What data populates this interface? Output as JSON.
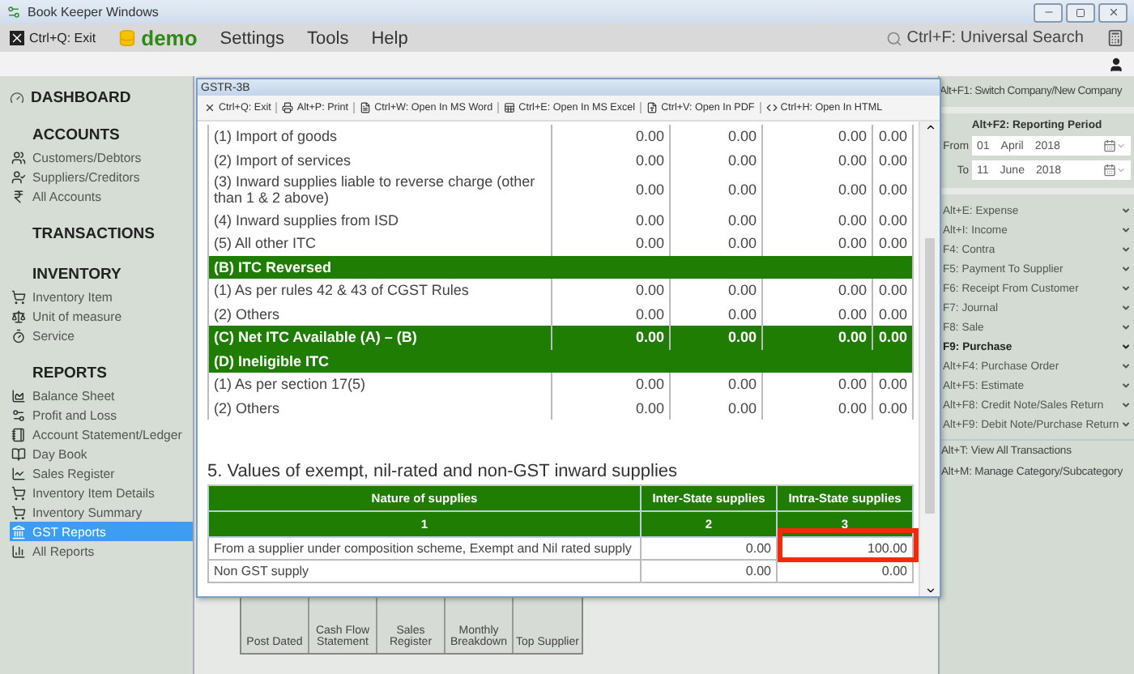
{
  "window": {
    "title": "Book Keeper Windows"
  },
  "menu_bar": {
    "exit": "Ctrl+Q: Exit",
    "company": "demo",
    "items": [
      "Settings",
      "Tools",
      "Help"
    ],
    "search": "Ctrl+F: Universal Search"
  },
  "sidebar": {
    "dashboard": "DASHBOARD",
    "sections": [
      {
        "title": "ACCOUNTS",
        "items": [
          {
            "label": "Customers/Debtors",
            "selected": false
          },
          {
            "label": "Suppliers/Creditors",
            "selected": false
          },
          {
            "label": "All Accounts",
            "selected": false
          }
        ]
      },
      {
        "title": "TRANSACTIONS"
      },
      {
        "title": "INVENTORY",
        "items": [
          {
            "label": "Inventory Item",
            "selected": false
          },
          {
            "label": "Unit of measure",
            "selected": false
          },
          {
            "label": "Service",
            "selected": false
          }
        ]
      },
      {
        "title": "REPORTS",
        "items": [
          {
            "label": "Balance Sheet",
            "selected": false
          },
          {
            "label": "Profit and Loss",
            "selected": false
          },
          {
            "label": "Account Statement/Ledger",
            "selected": false
          },
          {
            "label": "Day Book",
            "selected": false
          },
          {
            "label": "Sales Register",
            "selected": false
          },
          {
            "label": "Inventory Item Details",
            "selected": false
          },
          {
            "label": "Inventory Summary",
            "selected": false
          },
          {
            "label": "GST Reports",
            "selected": true
          },
          {
            "label": "All Reports",
            "selected": false
          }
        ]
      }
    ]
  },
  "dashboard_tiles": [
    "Post Dated",
    "Cash Flow Statement",
    "Sales Register",
    "Monthly Breakdown",
    "Top Supplier"
  ],
  "dialog": {
    "title": "GSTR-3B",
    "toolbar": [
      "Ctrl+Q: Exit",
      "Alt+P: Print",
      "Ctrl+W: Open In MS Word",
      "Ctrl+E: Open In MS Excel",
      "Ctrl+V: Open In PDF",
      "Ctrl+H: Open In HTML"
    ],
    "itc_rows": [
      {
        "kind": "item",
        "label": "(1) Import of goods",
        "values": [
          "0.00",
          "0.00",
          "0.00",
          "0.00"
        ]
      },
      {
        "kind": "item",
        "label": "(2) Import of services",
        "values": [
          "0.00",
          "0.00",
          "0.00",
          "0.00"
        ]
      },
      {
        "kind": "item",
        "label": "(3) Inward supplies liable to reverse charge (other than 1 & 2 above)",
        "values": [
          "0.00",
          "0.00",
          "0.00",
          "0.00"
        ]
      },
      {
        "kind": "item",
        "label": "(4) Inward supplies from ISD",
        "values": [
          "0.00",
          "0.00",
          "0.00",
          "0.00"
        ]
      },
      {
        "kind": "item",
        "label": "(5) All other ITC",
        "values": [
          "0.00",
          "0.00",
          "0.00",
          "0.00"
        ]
      },
      {
        "kind": "group",
        "label": "(B) ITC Reversed"
      },
      {
        "kind": "item",
        "label": "(1) As per rules 42 & 43 of CGST Rules",
        "values": [
          "0.00",
          "0.00",
          "0.00",
          "0.00"
        ]
      },
      {
        "kind": "item",
        "label": "(2) Others",
        "values": [
          "0.00",
          "0.00",
          "0.00",
          "0.00"
        ]
      },
      {
        "kind": "total",
        "label": "(C) Net ITC Available (A) – (B)",
        "values": [
          "0.00",
          "0.00",
          "0.00",
          "0.00"
        ]
      },
      {
        "kind": "group",
        "label": "(D) Ineligible ITC"
      },
      {
        "kind": "item",
        "label": "(1) As per section 17(5)",
        "values": [
          "0.00",
          "0.00",
          "0.00",
          "0.00"
        ]
      },
      {
        "kind": "item",
        "label": "(2) Others",
        "values": [
          "0.00",
          "0.00",
          "0.00",
          "0.00"
        ]
      }
    ],
    "section5": {
      "title": "5. Values of exempt, nil-rated and non-GST inward supplies",
      "columns": [
        "Nature of supplies",
        "Inter-State supplies",
        "Intra-State supplies"
      ],
      "column_numbers": [
        "1",
        "2",
        "3"
      ],
      "rows": [
        {
          "nature": "From a supplier under composition scheme, Exempt and Nil rated supply",
          "inter": "0.00",
          "intra": "100.00",
          "highlighted": true
        },
        {
          "nature": "Non GST supply",
          "inter": "0.00",
          "intra": "0.00",
          "highlighted": false
        }
      ]
    }
  },
  "right_panel": {
    "switch_company": "Alt+F1: Switch Company/New Company",
    "reporting_period": {
      "title": "Alt+F2: Reporting Period",
      "rows": [
        {
          "label": "From",
          "day": "01",
          "month": "April",
          "year": "2018"
        },
        {
          "label": "To",
          "day": "11",
          "month": "June",
          "year": "2018"
        }
      ]
    },
    "shortcuts": [
      {
        "label": "Alt+E: Expense",
        "selected": false
      },
      {
        "label": "Alt+I: Income",
        "selected": false
      },
      {
        "label": "F4: Contra",
        "selected": false
      },
      {
        "label": "F5: Payment To Supplier",
        "selected": false
      },
      {
        "label": "F6: Receipt From Customer",
        "selected": false
      },
      {
        "label": "F7: Journal",
        "selected": false
      },
      {
        "label": "F8: Sale",
        "selected": false
      },
      {
        "label": "F9: Purchase",
        "selected": true
      },
      {
        "label": "Alt+F4: Purchase Order",
        "selected": false
      },
      {
        "label": "Alt+F5: Estimate",
        "selected": false
      },
      {
        "label": "Alt+F8: Credit Note/Sales Return",
        "selected": false
      },
      {
        "label": "Alt+F9: Debit Note/Purchase Return",
        "selected": false
      }
    ],
    "links": [
      "Alt+T: View All Transactions",
      "Alt+M: Manage Category/Subcategory"
    ]
  }
}
